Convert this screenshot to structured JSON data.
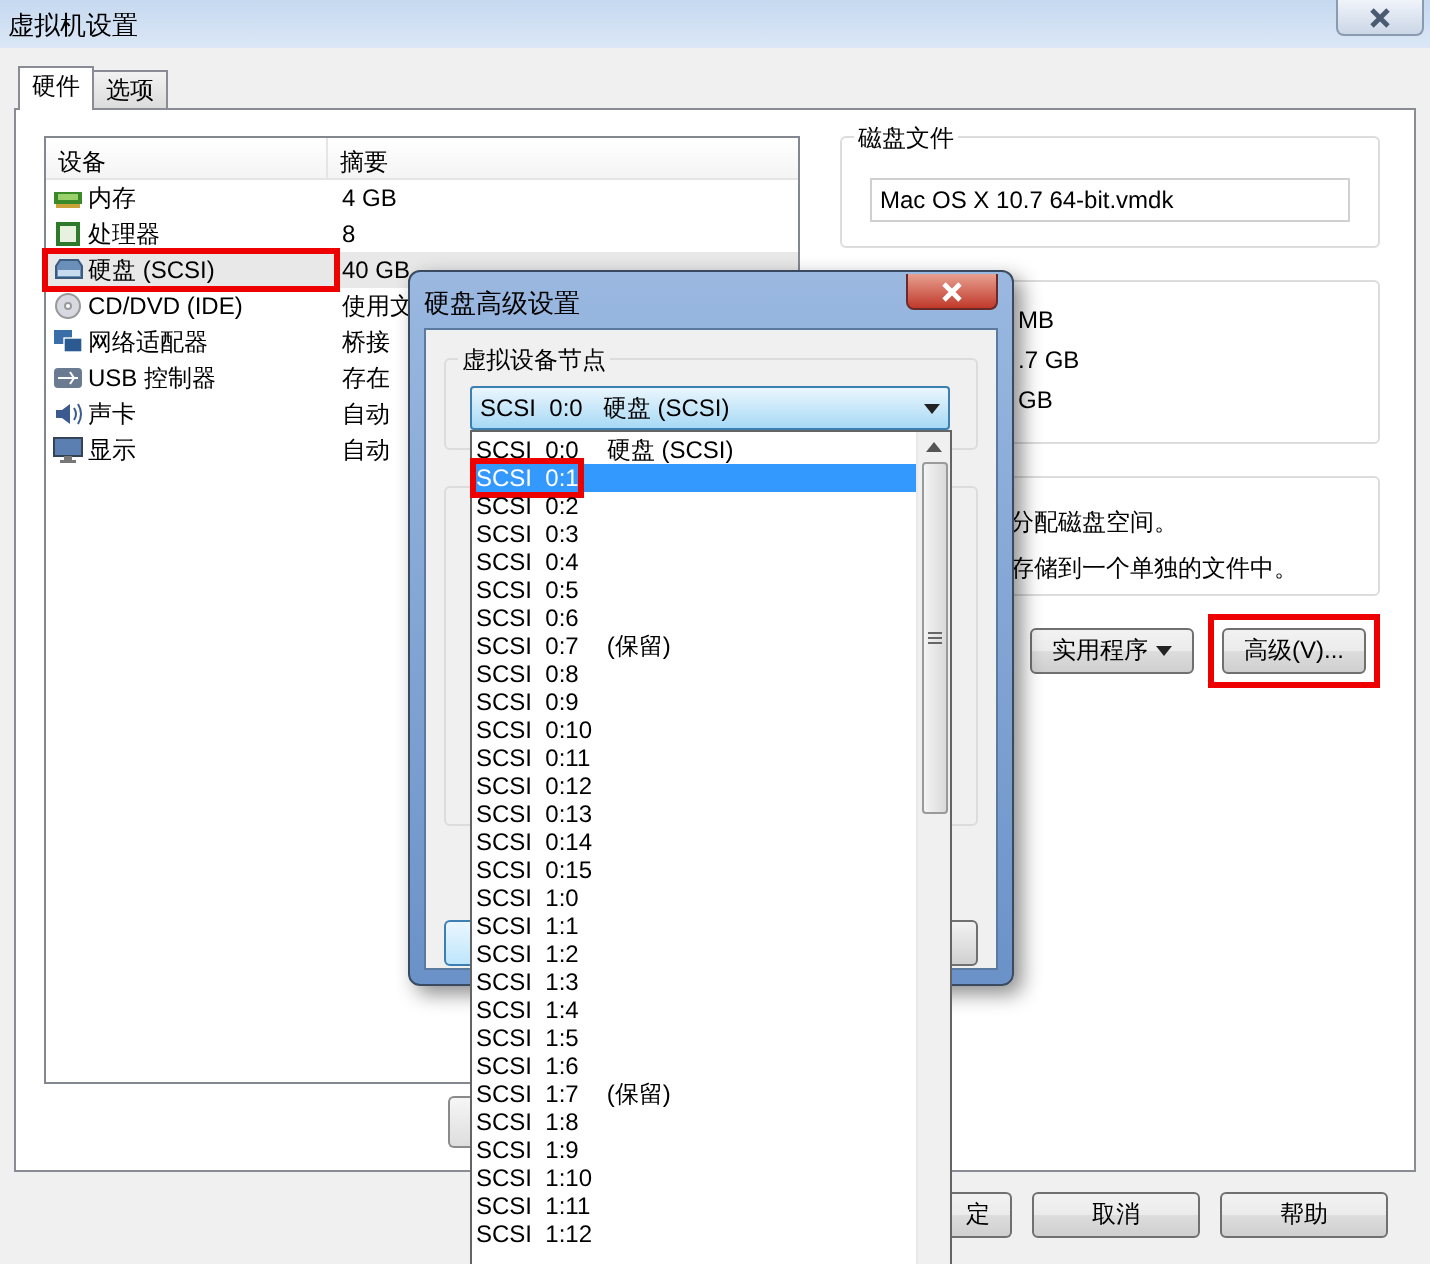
{
  "window": {
    "title": "虚拟机设置"
  },
  "tabs": [
    {
      "label": "硬件",
      "selected": true
    },
    {
      "label": "选项",
      "selected": false
    }
  ],
  "device_table": {
    "columns": [
      "设备",
      "摘要"
    ],
    "rows": [
      {
        "kind": "memory",
        "device": "内存",
        "summary": "4 GB",
        "selected": false,
        "highlighted": false
      },
      {
        "kind": "processor",
        "device": "处理器",
        "summary": "8",
        "selected": false,
        "highlighted": false
      },
      {
        "kind": "disk",
        "device": "硬盘 (SCSI)",
        "summary": "40 GB",
        "selected": true,
        "highlighted": true
      },
      {
        "kind": "cd",
        "device": "CD/DVD (IDE)",
        "summary": "使用文",
        "selected": false,
        "highlighted": false
      },
      {
        "kind": "network",
        "device": "网络适配器",
        "summary": "桥接",
        "selected": false,
        "highlighted": false
      },
      {
        "kind": "usb",
        "device": "USB 控制器",
        "summary": "存在",
        "selected": false,
        "highlighted": false
      },
      {
        "kind": "sound",
        "device": "声卡",
        "summary": "自动",
        "selected": false,
        "highlighted": false
      },
      {
        "kind": "display",
        "device": "显示",
        "summary": "自动",
        "selected": false,
        "highlighted": false
      }
    ]
  },
  "disk_file": {
    "title": "磁盘文件",
    "value": "Mac OS X 10.7 64-bit.vmdk"
  },
  "capacity_lines": [
    "MB",
    ".7 GB",
    "GB"
  ],
  "allocation_lines": [
    "分配磁盘空间。",
    "存储到一个单独的文件中。"
  ],
  "disk_buttons": [
    {
      "label": "实用程序",
      "dropdown": true,
      "highlighted": false
    },
    {
      "label": "高级(V)...",
      "dropdown": false,
      "highlighted": true
    }
  ],
  "footer_buttons": [
    "定",
    "取消",
    "帮助"
  ],
  "dialog": {
    "title": "硬盘高级设置",
    "group_title": "虚拟设备节点",
    "combo_value": "SCSI  0:0   硬盘 (SCSI)",
    "options": [
      {
        "node": "SCSI  0:0",
        "note": "硬盘 (SCSI)",
        "selected": false,
        "highlighted": false
      },
      {
        "node": "SCSI  0:1",
        "selected": true,
        "highlighted": true
      },
      {
        "node": "SCSI  0:2",
        "selected": false,
        "highlighted": false
      },
      {
        "node": "SCSI  0:3",
        "selected": false,
        "highlighted": false
      },
      {
        "node": "SCSI  0:4",
        "selected": false,
        "highlighted": false
      },
      {
        "node": "SCSI  0:5",
        "selected": false,
        "highlighted": false
      },
      {
        "node": "SCSI  0:6",
        "selected": false,
        "highlighted": false
      },
      {
        "node": "SCSI  0:7",
        "note": "(保留)",
        "selected": false,
        "highlighted": false
      },
      {
        "node": "SCSI  0:8",
        "selected": false,
        "highlighted": false
      },
      {
        "node": "SCSI  0:9",
        "selected": false,
        "highlighted": false
      },
      {
        "node": "SCSI  0:10",
        "selected": false,
        "highlighted": false
      },
      {
        "node": "SCSI  0:11",
        "selected": false,
        "highlighted": false
      },
      {
        "node": "SCSI  0:12",
        "selected": false,
        "highlighted": false
      },
      {
        "node": "SCSI  0:13",
        "selected": false,
        "highlighted": false
      },
      {
        "node": "SCSI  0:14",
        "selected": false,
        "highlighted": false
      },
      {
        "node": "SCSI  0:15",
        "selected": false,
        "highlighted": false
      },
      {
        "node": "SCSI  1:0",
        "selected": false,
        "highlighted": false
      },
      {
        "node": "SCSI  1:1",
        "selected": false,
        "highlighted": false
      },
      {
        "node": "SCSI  1:2",
        "selected": false,
        "highlighted": false
      },
      {
        "node": "SCSI  1:3",
        "selected": false,
        "highlighted": false
      },
      {
        "node": "SCSI  1:4",
        "selected": false,
        "highlighted": false
      },
      {
        "node": "SCSI  1:5",
        "selected": false,
        "highlighted": false
      },
      {
        "node": "SCSI  1:6",
        "selected": false,
        "highlighted": false
      },
      {
        "node": "SCSI  1:7",
        "note": "(保留)",
        "selected": false,
        "highlighted": false
      },
      {
        "node": "SCSI  1:8",
        "selected": false,
        "highlighted": false
      },
      {
        "node": "SCSI  1:9",
        "selected": false,
        "highlighted": false
      },
      {
        "node": "SCSI  1:10",
        "selected": false,
        "highlighted": false
      },
      {
        "node": "SCSI  1:11",
        "selected": false,
        "highlighted": false
      },
      {
        "node": "SCSI  1:12",
        "selected": false,
        "highlighted": false
      }
    ]
  }
}
